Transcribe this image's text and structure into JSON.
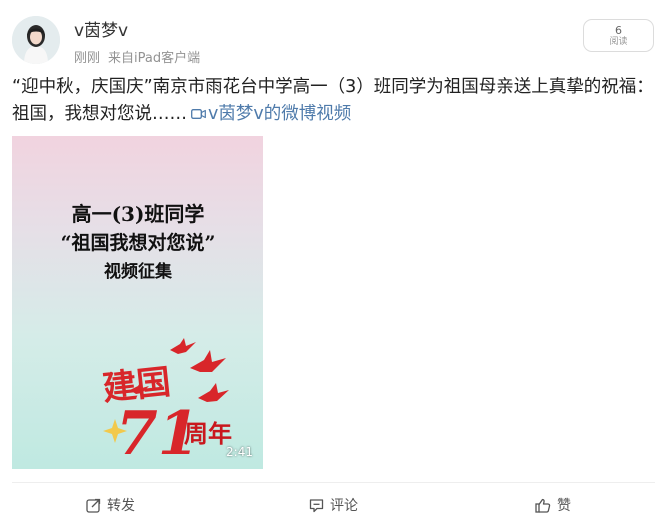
{
  "user": {
    "name": "v茵梦v",
    "time": "刚刚",
    "source": "来自iPad客户端"
  },
  "views": {
    "count": "6",
    "label": "阅读"
  },
  "post": {
    "text": "“迎中秋，庆国庆”南京市雨花台中学高一（3）班同学为祖国母亲送上真挚的祝福：祖国，我想对您说……",
    "video_link": "v茵梦v的微博视频"
  },
  "video": {
    "title_line1": "高一(3)班同学",
    "title_line2": "“祖国我想对您说”",
    "title_line3": "视频征集",
    "banner_1": "建国",
    "banner_number": "71",
    "banner_2": "周年",
    "duration": "2:41",
    "accent_color": "#d8262a"
  },
  "actions": {
    "repost": "转发",
    "comment": "评论",
    "like": "赞"
  }
}
